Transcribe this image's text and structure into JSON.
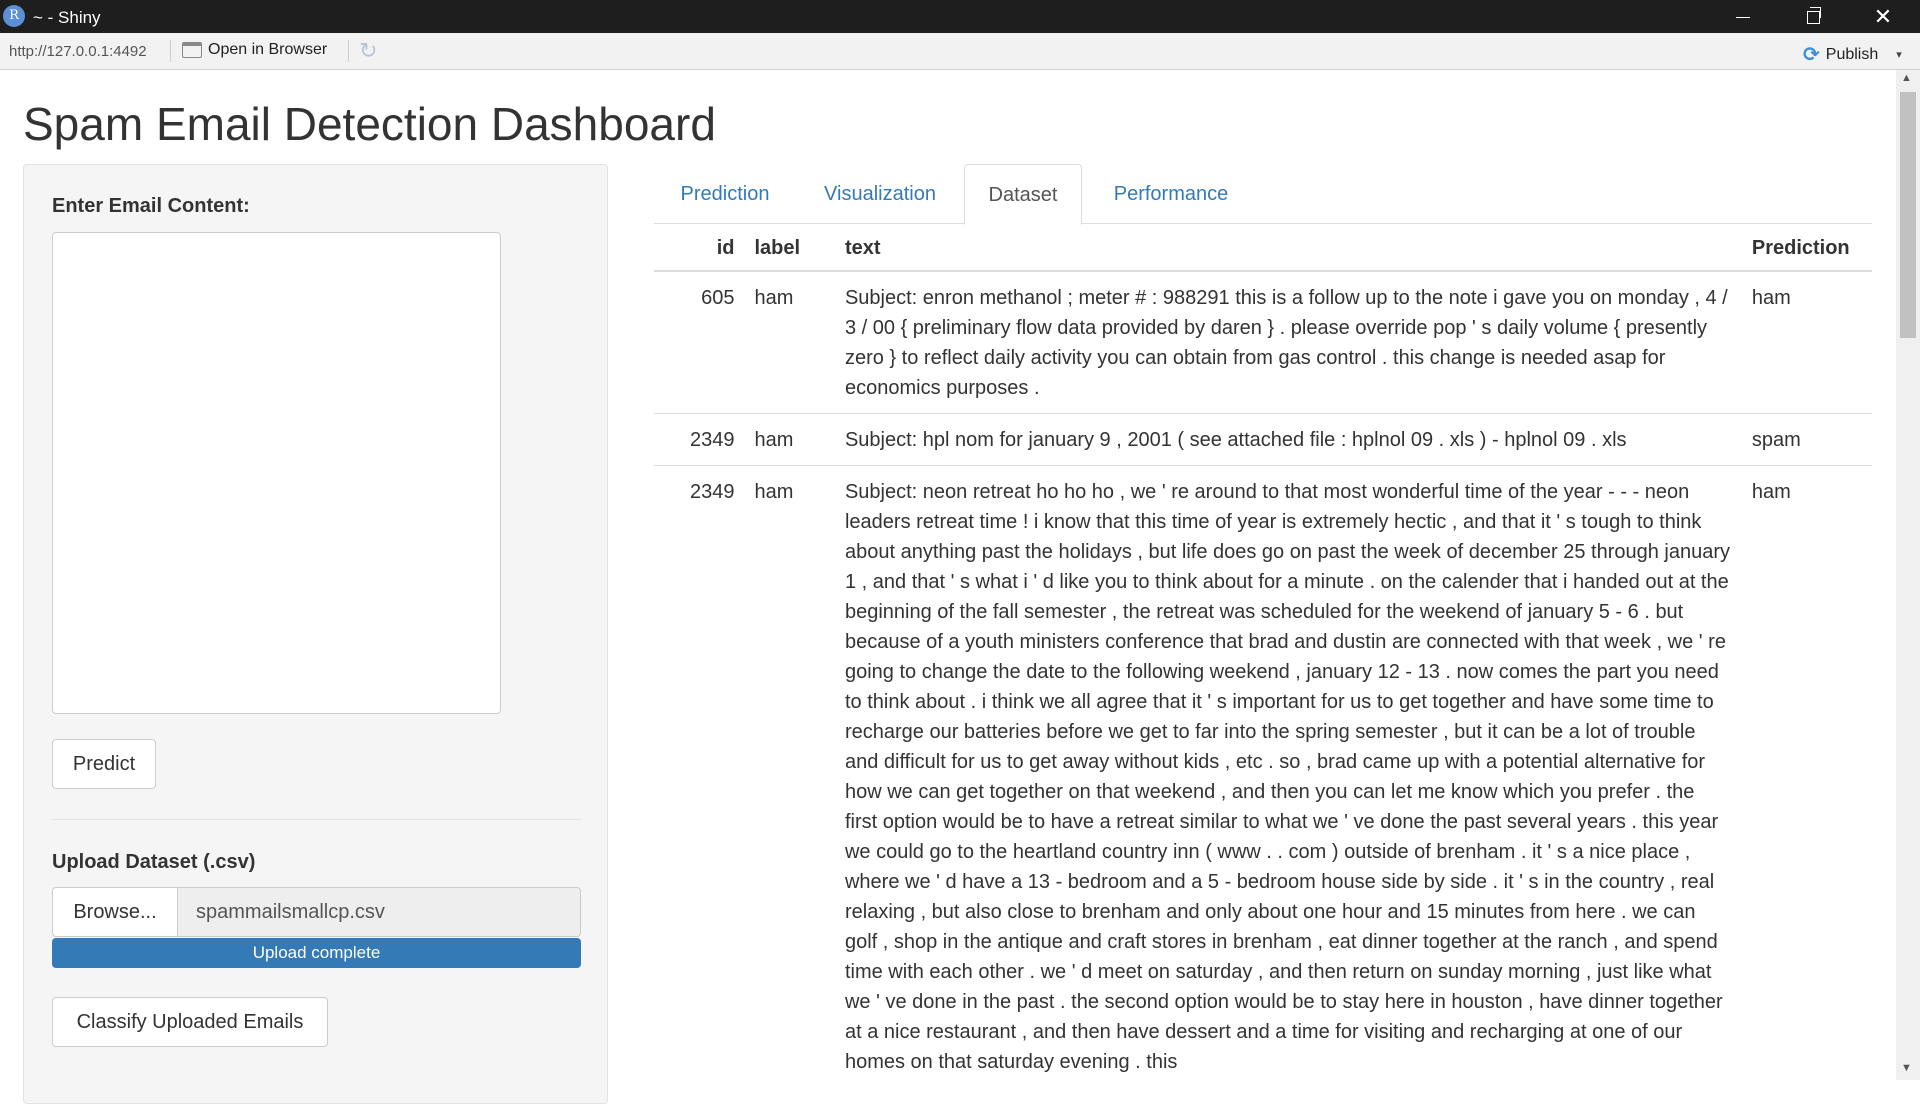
{
  "window": {
    "app_icon": "R",
    "title": "~ - Shiny",
    "controls": {
      "minimize": "minimize-icon",
      "maximize": "maximize-icon",
      "close": "✕"
    }
  },
  "toolbar": {
    "url": "http://127.0.0.1:4492",
    "open_browser_label": "Open in Browser",
    "refresh_icon": "↻",
    "publish_label": "Publish",
    "publish_caret": "▾"
  },
  "app": {
    "title": "Spam Email Detection Dashboard",
    "sidebar": {
      "email_label": "Enter Email Content:",
      "email_value": "",
      "predict_label": "Predict",
      "upload_label": "Upload Dataset (.csv)",
      "browse_label": "Browse...",
      "file_name": "spammailsmallcp.csv",
      "progress_text": "Upload complete",
      "progress_value": 1.0,
      "classify_label": "Classify Uploaded Emails"
    },
    "tabs": [
      {
        "label": "Prediction",
        "active": false
      },
      {
        "label": "Visualization",
        "active": false
      },
      {
        "label": "Dataset",
        "active": true
      },
      {
        "label": "Performance",
        "active": false
      }
    ],
    "table": {
      "columns": [
        "id",
        "label",
        "text",
        "Prediction"
      ],
      "rows": [
        {
          "id": "605",
          "label": "ham",
          "text": "Subject: enron methanol ; meter # : 988291 this is a follow up to the note i gave you on monday , 4 / 3 / 00 { preliminary flow data provided by daren } . please override pop ' s daily volume { presently zero } to reflect daily activity you can obtain from gas control . this change is needed asap for economics purposes .",
          "prediction": "ham"
        },
        {
          "id": "2349",
          "label": "ham",
          "text": "Subject: hpl nom for january 9 , 2001 ( see attached file : hplnol 09 . xls ) - hplnol 09 . xls",
          "prediction": "spam"
        },
        {
          "id": "2349",
          "label": "ham",
          "text": "Subject: neon retreat ho ho ho , we ' re around to that most wonderful time of the year - - - neon leaders retreat time ! i know that this time of year is extremely hectic , and that it ' s tough to think about anything past the holidays , but life does go on past the week of december 25 through january 1 , and that ' s what i ' d like you to think about for a minute . on the calender that i handed out at the beginning of the fall semester , the retreat was scheduled for the weekend of january 5 - 6 . but because of a youth ministers conference that brad and dustin are connected with that week , we ' re going to change the date to the following weekend , january 12 - 13 . now comes the part you need to think about . i think we all agree that it ' s important for us to get together and have some time to recharge our batteries before we get to far into the spring semester , but it can be a lot of trouble and difficult for us to get away without kids , etc . so , brad came up with a potential alternative for how we can get together on that weekend , and then you can let me know which you prefer . the first option would be to have a retreat similar to what we ' ve done the past several years . this year we could go to the heartland country inn ( www . . com ) outside of brenham . it ' s a nice place , where we ' d have a 13 - bedroom and a 5 - bedroom house side by side . it ' s in the country , real relaxing , but also close to brenham and only about one hour and 15 minutes from here . we can golf , shop in the antique and craft stores in brenham , eat dinner together at the ranch , and spend time with each other . we ' d meet on saturday , and then return on sunday morning , just like what we ' ve done in the past . the second option would be to stay here in houston , have dinner together at a nice restaurant , and then have dessert and a time for visiting and recharging at one of our homes on that saturday evening . this",
          "prediction": "ham"
        }
      ]
    }
  }
}
